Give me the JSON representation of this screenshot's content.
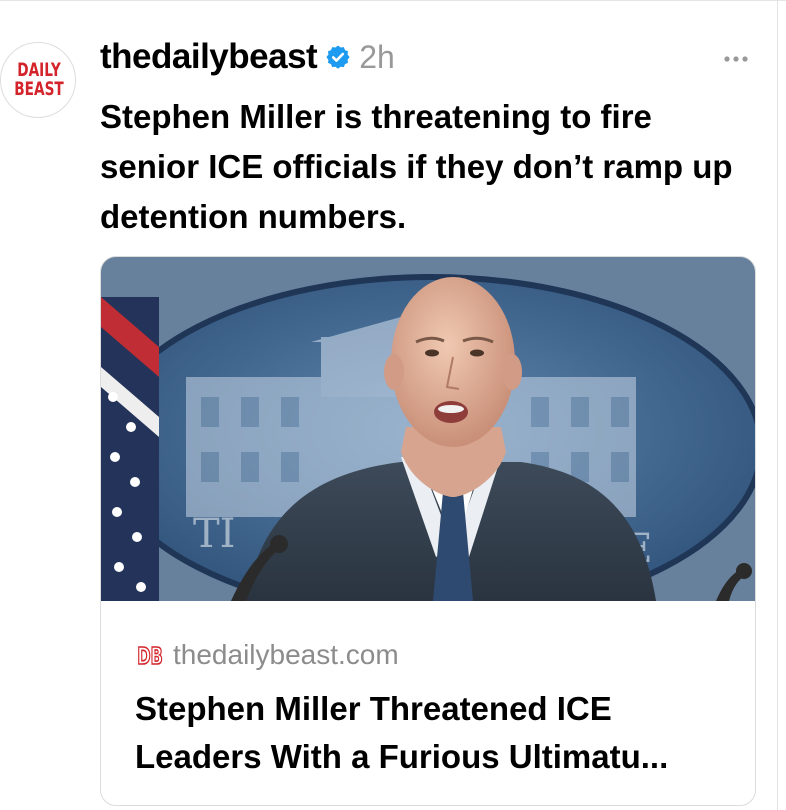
{
  "post": {
    "avatar": {
      "text": "DAILY BEAST",
      "brand_color": "#d3242b"
    },
    "username": "thedailybeast",
    "verified_icon": "verified-badge-icon",
    "verified_color": "#1d9bf0",
    "timestamp": "2h",
    "more_icon": "more-horizontal-icon",
    "caption": "Stephen Miller is threatening to fire senior ICE officials if they don’t ramp up detention numbers.",
    "link_card": {
      "image_icon": "press-briefing-photo",
      "source_logo": "DB",
      "source_domain": "thedailybeast.com",
      "title": "Stephen Miller Threatened ICE Leaders With a Furious Ultimatu..."
    }
  }
}
